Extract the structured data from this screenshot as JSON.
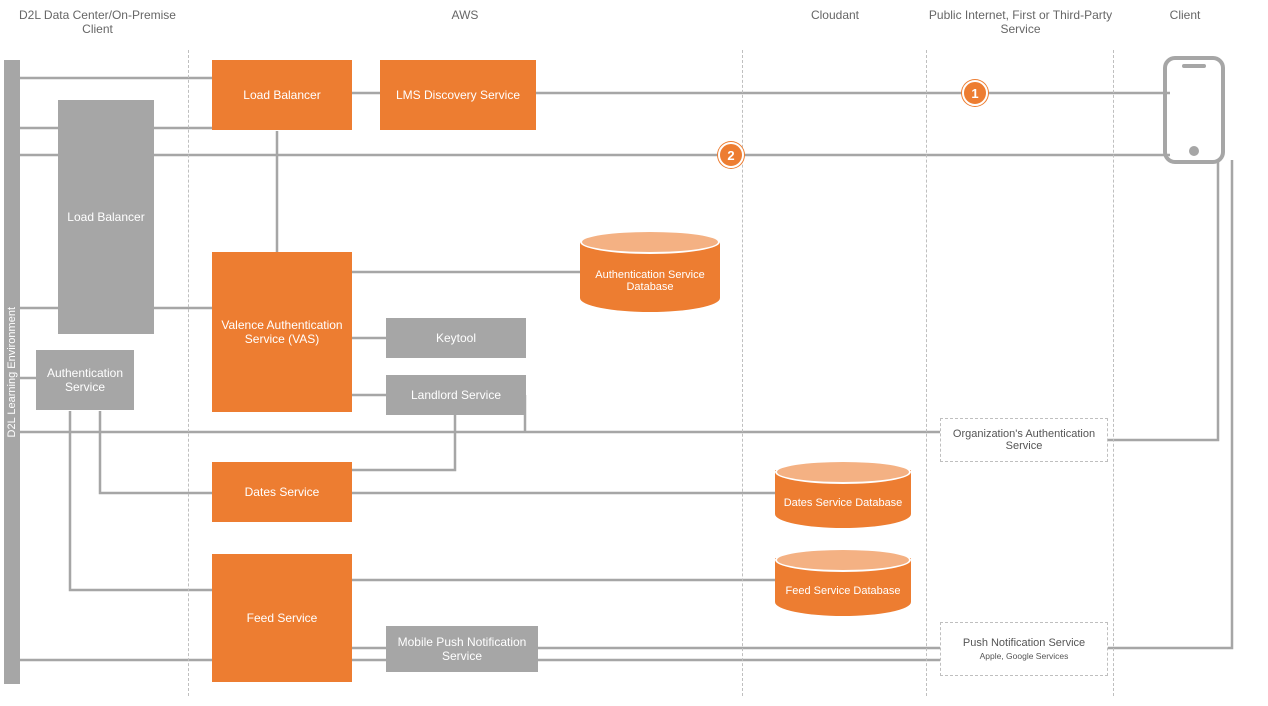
{
  "columns": {
    "d2l": "D2L Data Center/On-Premise Client",
    "aws": "AWS",
    "cloudant": "Cloudant",
    "public": "Public Internet, First or Third-Party Service",
    "client": "Client"
  },
  "d2l_env": "D2L Learning Environment",
  "boxes": {
    "lb_onprem": "Load Balancer",
    "lb_aws": "Load Balancer",
    "lms": "LMS Discovery Service",
    "auth_onprem": "Authentication Service",
    "vas": "Valence Authentication Service (VAS)",
    "keytool": "Keytool",
    "landlord": "Landlord Service",
    "dates": "Dates Service",
    "feed": "Feed Service",
    "push_mobile": "Mobile Push Notification Service"
  },
  "databases": {
    "auth": "Authentication Service Database",
    "dates": "Dates Service Database",
    "feed": "Feed Service Database"
  },
  "external": {
    "org_auth": "Organization's Authentication Service",
    "push": "Push Notification Service",
    "push_sub": "Apple, Google Services"
  },
  "markers": {
    "one": "1",
    "two": "2"
  },
  "colors": {
    "orange": "#ED7D31",
    "orange_light": "#F4B183",
    "gray": "#A6A6A6"
  }
}
